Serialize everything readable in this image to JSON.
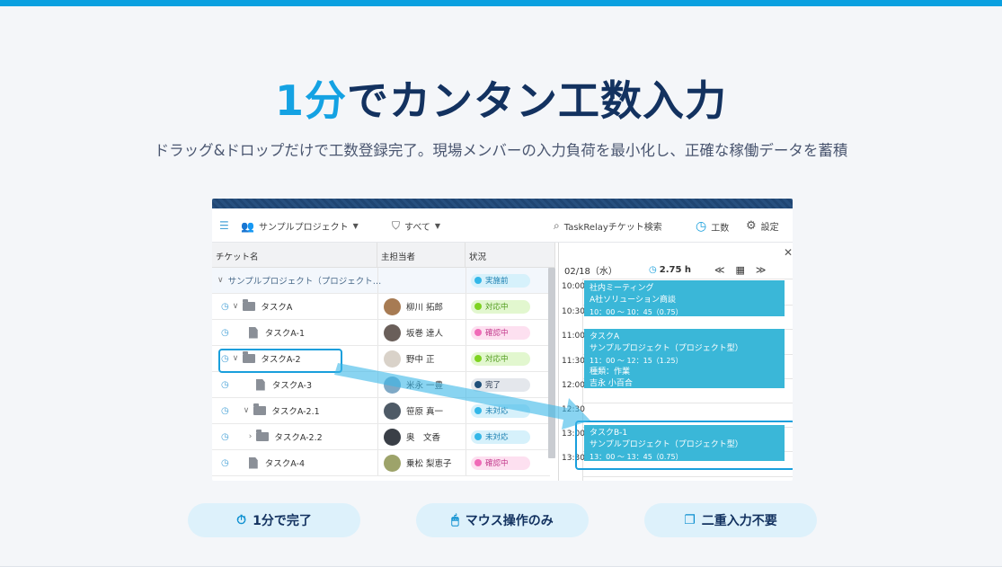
{
  "headline": {
    "accent": "1分",
    "rest": "でカンタン工数入力"
  },
  "subline": "ドラッグ&ドロップだけで工数登録完了。現場メンバーの入力負荷を最小化し、正確な稼働データを蓄積",
  "app": {
    "toolbar": {
      "project": "サンプルプロジェクト",
      "filter": "すべて",
      "search_placeholder": "TaskRelayチケット検索",
      "worklog": "工数",
      "settings": "設定"
    },
    "columns": {
      "ticket": "チケット名",
      "assignee": "主担当者",
      "status": "状況"
    },
    "rows": [
      {
        "name": "サンプルプロジェクト（プロジェクト…",
        "person": "",
        "status": "実施前"
      },
      {
        "name": "タスクA",
        "person": "柳川 拓郎",
        "status": "対応中"
      },
      {
        "name": "タスクA-1",
        "person": "坂巻 達人",
        "status": "確認中"
      },
      {
        "name": "タスクA-2",
        "person": "野中 正",
        "status": "対応中"
      },
      {
        "name": "タスクA-3",
        "person": "米永 一豊",
        "status": "完了"
      },
      {
        "name": "タスクA-2.1",
        "person": "笹原 真一",
        "status": "未対応"
      },
      {
        "name": "タスクA-2.2",
        "person": "奥　文香",
        "status": "未対応"
      },
      {
        "name": "タスクA-4",
        "person": "乗松 梨恵子",
        "status": "確認中"
      }
    ],
    "calendar": {
      "date": "02/18（水）",
      "total_hours": "2.75 h",
      "times": [
        "10:00",
        "10:30",
        "11:00",
        "11:30",
        "12:00",
        "12:30",
        "13:00",
        "13:30"
      ],
      "events": [
        {
          "title": "社内ミーティング",
          "line2": "A社ソリューション商談",
          "time": "10：00 〜 10：45（0.75）"
        },
        {
          "title": "タスクA",
          "line2": "サンプルプロジェクト（プロジェクト型）",
          "time": "11：00 〜 12：15（1.25）",
          "line4": "種類：作業",
          "line5": "吉永 小百合"
        },
        {
          "title": "タスクB-1",
          "line2": "サンプルプロジェクト（プロジェクト型）",
          "time": "13：00 〜 13：45（0.75）"
        }
      ]
    }
  },
  "features": [
    {
      "label": "1分で完了",
      "icon": "stopwatch-icon"
    },
    {
      "label": "マウス操作のみ",
      "icon": "mouse-icon"
    },
    {
      "label": "二重入力不要",
      "icon": "copy-icon"
    }
  ],
  "colors": {
    "accent": "#14a2e3",
    "navy": "#133260",
    "event": "#3ab7d8"
  }
}
